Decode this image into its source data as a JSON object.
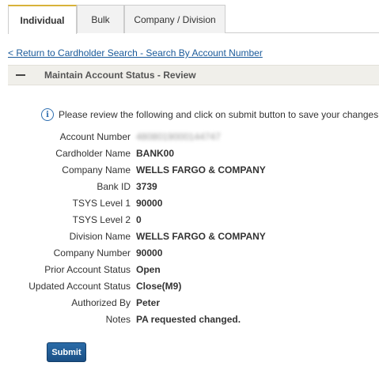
{
  "tabs": [
    {
      "label": "Individual"
    },
    {
      "label": "Bulk"
    },
    {
      "label": "Company / Division"
    }
  ],
  "return_link": "< Return to Cardholder Search - Search By Account Number",
  "section": {
    "title": "Maintain Account Status - Review"
  },
  "info_message": "Please review the following and click on submit button to save your changes",
  "fields": [
    {
      "label": "Account Number",
      "value": "4808019000144747"
    },
    {
      "label": "Cardholder Name",
      "value": "BANK00"
    },
    {
      "label": "Company Name",
      "value": "WELLS FARGO & COMPANY"
    },
    {
      "label": "Bank ID",
      "value": "3739"
    },
    {
      "label": "TSYS Level 1",
      "value": "90000"
    },
    {
      "label": "TSYS Level 2",
      "value": "0"
    },
    {
      "label": "Division Name",
      "value": "WELLS FARGO & COMPANY"
    },
    {
      "label": "Company Number",
      "value": "90000"
    },
    {
      "label": "Prior Account Status",
      "value": "Open"
    },
    {
      "label": "Updated Account Status",
      "value": "Close(M9)"
    },
    {
      "label": "Authorized By",
      "value": "Peter"
    },
    {
      "label": "Notes",
      "value": "PA requested changed."
    }
  ],
  "submit_label": "Submit",
  "colors": {
    "accent": "#d8b23a",
    "link": "#1a5a9a",
    "button": "#1f5d99",
    "info": "#2f6fb1"
  }
}
